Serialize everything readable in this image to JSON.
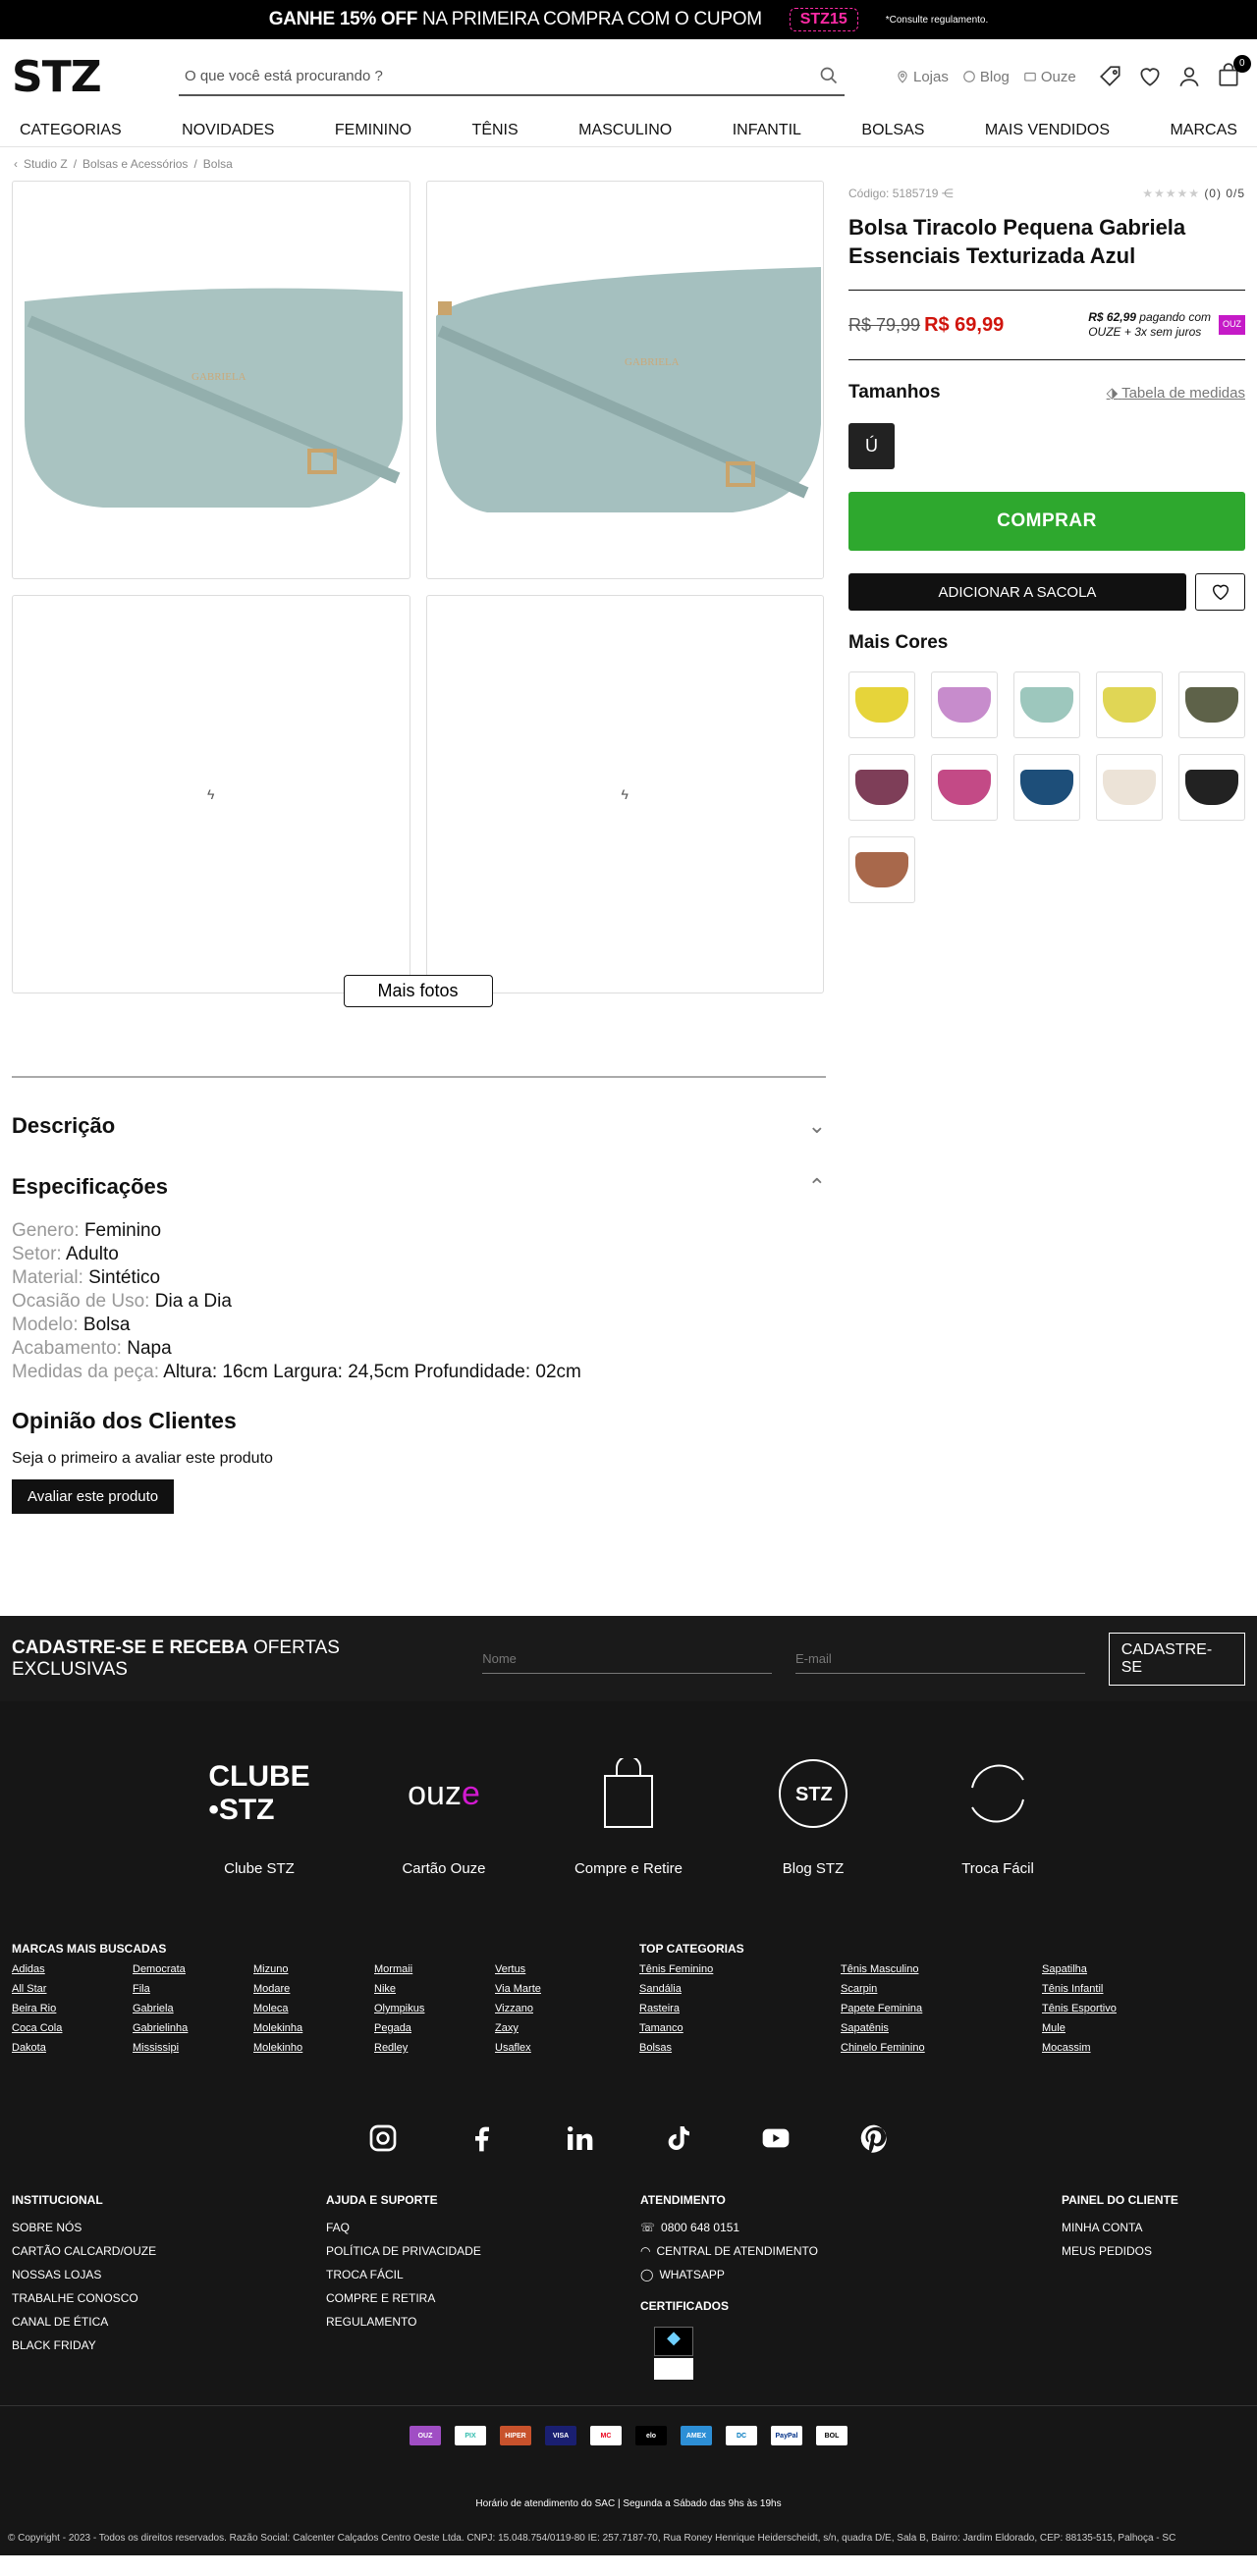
{
  "topbar": {
    "promo_bold": "GANHE 15% OFF",
    "promo_text": "NA PRIMEIRA COMPRA COM O CUPOM",
    "coupon": "STZ15",
    "rules": "*Consulte regulamento."
  },
  "header": {
    "logo": "STZ",
    "search_placeholder": "O que você está procurando ?",
    "links": [
      "Lojas",
      "Blog",
      "Ouze"
    ],
    "cart_count": "0"
  },
  "nav": [
    "CATEGORIAS",
    "NOVIDADES",
    "FEMININO",
    "TÊNIS",
    "MASCULINO",
    "INFANTIL",
    "BOLSAS",
    "MAIS VENDIDOS",
    "MARCAS"
  ],
  "breadcrumb": [
    "Studio Z",
    "Bolsas e Acessórios",
    "Bolsa"
  ],
  "gallery": {
    "more_photos": "Mais fotos"
  },
  "product": {
    "code": "Código: 5185719",
    "rating": "(0) 0/5",
    "title": "Bolsa Tiracolo Pequena Gabriela Essenciais Texturizada Azul",
    "old_price": "R$ 79,99",
    "price": "R$ 69,99",
    "installment_price": "R$ 62,99",
    "installment_text": "pagando com",
    "installment_line2": "OUZE + 3x",
    "installment_line3": "sem juros",
    "ouze_badge": "OUZ",
    "sizes_title": "Tamanhos",
    "size_chart": "Tabela de medidas",
    "size": "Ú",
    "buy": "COMPRAR",
    "add_bag": "ADICIONAR A SACOLA",
    "more_colors": "Mais Cores",
    "colors": [
      "#e6d43a",
      "#c78ccc",
      "#9dc7bd",
      "#e0d655",
      "#5e6249",
      "#7e3e58",
      "#c34a86",
      "#1d4e79",
      "#ece3d7",
      "#222222",
      "#a8684b"
    ]
  },
  "details": {
    "description": "Descrição",
    "specs_title": "Especificações",
    "specs": [
      {
        "k": "Genero:",
        "v": "Feminino"
      },
      {
        "k": "Setor:",
        "v": "Adulto"
      },
      {
        "k": "Material:",
        "v": "Sintético"
      },
      {
        "k": "Ocasião de Uso:",
        "v": "Dia a Dia"
      },
      {
        "k": "Modelo:",
        "v": "Bolsa"
      },
      {
        "k": "Acabamento:",
        "v": "Napa"
      },
      {
        "k": "Medidas da peça:",
        "v": "Altura: 16cm Largura: 24,5cm Profundidade: 02cm"
      }
    ],
    "reviews_title": "Opinião dos Clientes",
    "reviews_text": "Seja o primeiro a avaliar este produto",
    "review_button": "Avaliar este produto"
  },
  "newsletter": {
    "bold": "CADASTRE-SE E RECEBA",
    "text": "OFERTAS EXCLUSIVAS",
    "name_ph": "Nome",
    "email_ph": "E-mail",
    "button": "CADASTRE-SE"
  },
  "services": [
    "Clube STZ",
    "Cartão Ouze",
    "Compre e Retire",
    "Blog STZ",
    "Troca Fácil"
  ],
  "brands": {
    "title": "MARCAS MAIS BUSCADAS",
    "items": [
      "Adidas",
      "All Star",
      "Beira Rio",
      "Coca Cola",
      "Dakota",
      "Democrata",
      "Fila",
      "Gabriela",
      "Gabrielinha",
      "Mississipi",
      "Mizuno",
      "Modare",
      "Moleca",
      "Molekinha",
      "Molekinho",
      "Mormaii",
      "Nike",
      "Olympikus",
      "Pegada",
      "Redley",
      "Vertus",
      "Via Marte",
      "Vizzano",
      "Zaxy",
      "Usaflex"
    ]
  },
  "topcats": {
    "title": "TOP CATEGORIAS",
    "items": [
      "Tênis Feminino",
      "Sandália",
      "Rasteira",
      "Tamanco",
      "Bolsas",
      "Tênis Masculino",
      "Scarpin",
      "Papete Feminina",
      "Sapatênis",
      "Chinelo Feminino",
      "Sapatilha",
      "Tênis Infantil",
      "Tênis Esportivo",
      "Mule",
      "Mocassim"
    ]
  },
  "institucional": {
    "title": "INSTITUCIONAL",
    "items": [
      "SOBRE NÓS",
      "CARTÃO CALCARD/OUZE",
      "NOSSAS LOJAS",
      "TRABALHE CONOSCO",
      "CANAL DE ÉTICA",
      "BLACK FRIDAY"
    ]
  },
  "ajuda": {
    "title": "AJUDA E SUPORTE",
    "items": [
      "FAQ",
      "POLÍTICA DE PRIVACIDADE",
      "TROCA FÁCIL",
      "COMPRE E RETIRA",
      "REGULAMENTO"
    ]
  },
  "atendimento": {
    "title": "ATENDIMENTO",
    "items": [
      "0800 648 0151",
      "CENTRAL DE ATENDIMENTO",
      "WHATSAPP"
    ],
    "cert_title": "CERTIFICADOS"
  },
  "painel": {
    "title": "PAINEL DO CLIENTE",
    "items": [
      "MINHA CONTA",
      "MEUS PEDIDOS"
    ]
  },
  "payments": [
    "OUZ",
    "PIX",
    "HIPER",
    "VISA",
    "MC",
    "elo",
    "AMEX",
    "DC",
    "PayPal",
    "BOL"
  ],
  "hours": "Horário de atendimento do SAC | Segunda a Sábado das 9hs às 19hs",
  "copyright": "© Copyright - 2023 - Todos os direitos reservados. Razão Social: Calcenter Calçados Centro Oeste Ltda. CNPJ: 15.048.754/0119-80 IE: 257.7187-70, Rua Roney Henrique Heiderscheidt, s/n, quadra D/E, Sala B, Bairro: Jardim Eldorado, CEP: 88135-515, Palhoça - SC"
}
